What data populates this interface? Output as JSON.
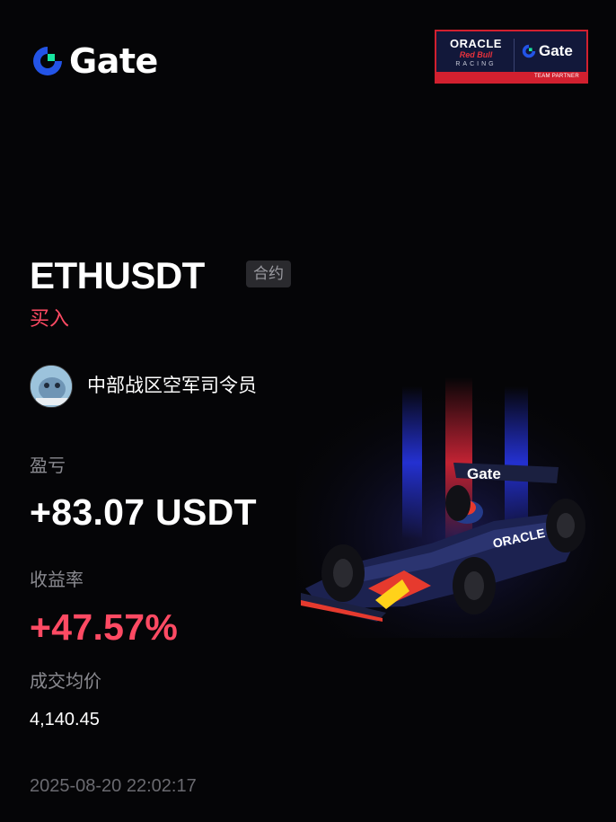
{
  "brand": {
    "logo_text": "Gate",
    "logo_icon": "gate-logo-icon",
    "brand_blue": "#2354e6",
    "brand_green": "#17e6a1"
  },
  "partner": {
    "oracle": "ORACLE",
    "redbull": "Red Bull",
    "racing": "RACING",
    "gate_text": "Gate",
    "tagline": "TEAM PARTNER"
  },
  "trade": {
    "symbol": "ETHUSDT",
    "contract_badge": "合约",
    "side": "买入",
    "side_color": "#ff4a63"
  },
  "user": {
    "name": "中部战区空军司令员",
    "avatar_icon": "avatar-icon"
  },
  "stats": {
    "pnl_label": "盈亏",
    "pnl_value": "+83.07 USDT",
    "roi_label": "收益率",
    "roi_value": "+47.57%",
    "avg_price_label": "成交均价",
    "avg_price_value": "4,140.45"
  },
  "timestamp": "2025-08-20 22:02:17",
  "car_image": {
    "livery_text": "Gate",
    "sidepod_text": "ORACLE"
  }
}
